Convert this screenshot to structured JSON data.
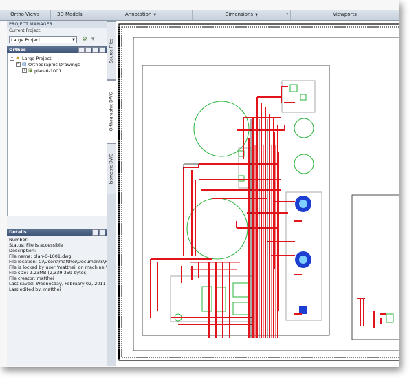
{
  "ribbon": {
    "tabs": [
      {
        "label": "Ortho Views",
        "dropdown": false
      },
      {
        "label": "3D Models",
        "dropdown": false
      },
      {
        "label": "Annotation",
        "dropdown": true
      },
      {
        "label": "Dimensions",
        "dropdown": true
      },
      {
        "label": "Viewports",
        "dropdown": false
      }
    ]
  },
  "project_manager": {
    "title": "PROJECT MANAGER",
    "current_project_label": "Current Project:",
    "current_project_value": "Large Project"
  },
  "orthos": {
    "header": "Orthos",
    "tree": {
      "root": "Large Project",
      "folder": "Orthographic Drawings",
      "drawing": "plan-6-1001"
    }
  },
  "vertical_tabs": [
    "Source Files",
    "Orthographic DWG",
    "Isometric DWG"
  ],
  "details": {
    "header": "Details",
    "lines": [
      "Number:",
      "Status: File is accessible",
      "Description:",
      "File name: plan-6-1001.dwg",
      "File location: C:\\Users\\matthei\\Documents\\P3",
      "File is locked by user 'matthei' on machine 'C",
      "File size: 2.23MB (2,339,359 bytes)",
      "File creator: matthei",
      "Last saved: Wednesday, February 02, 2011 5:1",
      "Last edited by: matthei"
    ]
  },
  "colors": {
    "pipe_red": "#e0141a",
    "equipment_green": "#29b33a",
    "blue_equipment": "#1d3fd1",
    "ribbon_bg": "#c6d0dc",
    "panel_header": "#4a6184"
  }
}
